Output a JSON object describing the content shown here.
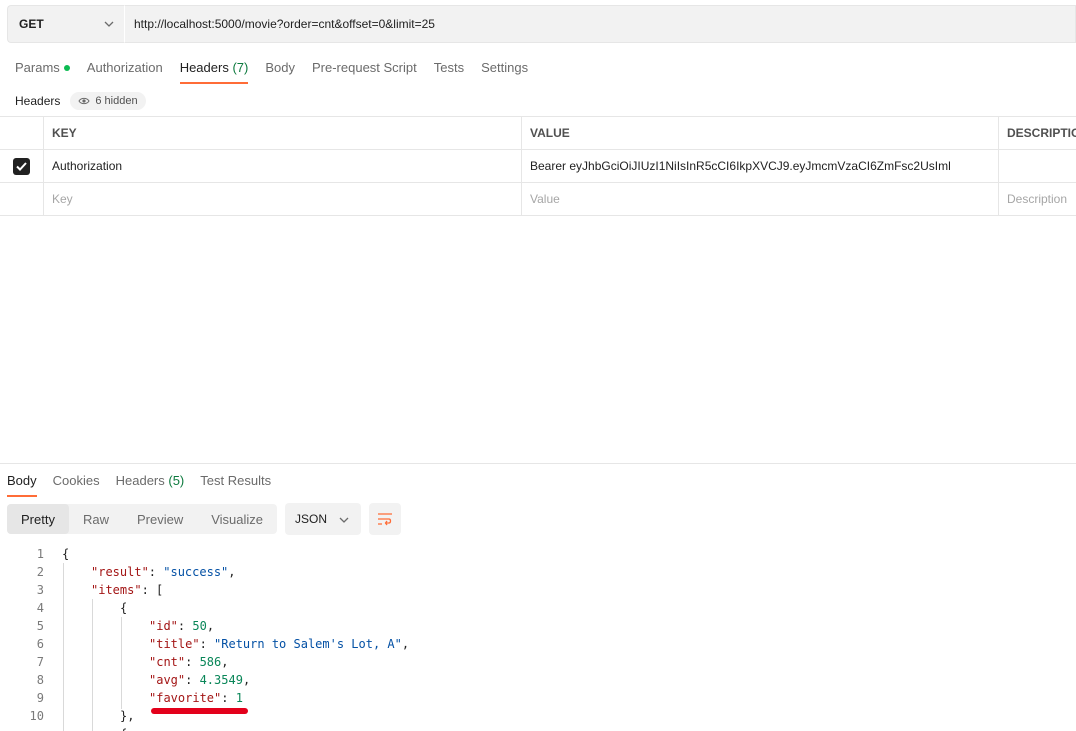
{
  "request": {
    "method": "GET",
    "url": "http://localhost:5000/movie?order=cnt&offset=0&limit=25"
  },
  "request_tabs": [
    {
      "label": "Params",
      "count": "",
      "active": false,
      "dot": true
    },
    {
      "label": "Authorization",
      "count": "",
      "active": false,
      "dot": false
    },
    {
      "label": "Headers",
      "count": "(7)",
      "active": true,
      "dot": false
    },
    {
      "label": "Body",
      "count": "",
      "active": false,
      "dot": false
    },
    {
      "label": "Pre-request Script",
      "count": "",
      "active": false,
      "dot": false
    },
    {
      "label": "Tests",
      "count": "",
      "active": false,
      "dot": false
    },
    {
      "label": "Settings",
      "count": "",
      "active": false,
      "dot": false
    }
  ],
  "headers_section": {
    "label": "Headers",
    "hidden_label": "6 hidden"
  },
  "headers_table": {
    "columns": [
      "KEY",
      "VALUE",
      "DESCRIPTIO"
    ],
    "rows": [
      {
        "checked": true,
        "key": "Authorization",
        "value": "Bearer eyJhbGciOiJIUzI1NiIsInR5cCI6IkpXVCJ9.eyJmcmVzaCI6ZmFsc2UsIml",
        "description": ""
      }
    ],
    "placeholder": {
      "key": "Key",
      "value": "Value",
      "description": "Description"
    }
  },
  "response_tabs": [
    {
      "label": "Body",
      "count": "",
      "active": true
    },
    {
      "label": "Cookies",
      "count": "",
      "active": false
    },
    {
      "label": "Headers",
      "count": "(5)",
      "active": false
    },
    {
      "label": "Test Results",
      "count": "",
      "active": false
    }
  ],
  "view_modes": [
    {
      "label": "Pretty",
      "active": true
    },
    {
      "label": "Raw",
      "active": false
    },
    {
      "label": "Preview",
      "active": false
    },
    {
      "label": "Visualize",
      "active": false
    }
  ],
  "format_select": "JSON",
  "code_lines": [
    {
      "n": "1",
      "indent": 0,
      "parts": [
        [
          "p",
          "{"
        ]
      ]
    },
    {
      "n": "2",
      "indent": 1,
      "parts": [
        [
          "k",
          "\"result\""
        ],
        [
          "p",
          ": "
        ],
        [
          "s",
          "\"success\""
        ],
        [
          "p",
          ","
        ]
      ]
    },
    {
      "n": "3",
      "indent": 1,
      "parts": [
        [
          "k",
          "\"items\""
        ],
        [
          "p",
          ": ["
        ]
      ]
    },
    {
      "n": "4",
      "indent": 2,
      "parts": [
        [
          "p",
          "{"
        ]
      ]
    },
    {
      "n": "5",
      "indent": 3,
      "parts": [
        [
          "k",
          "\"id\""
        ],
        [
          "p",
          ": "
        ],
        [
          "n",
          "50"
        ],
        [
          "p",
          ","
        ]
      ]
    },
    {
      "n": "6",
      "indent": 3,
      "parts": [
        [
          "k",
          "\"title\""
        ],
        [
          "p",
          ": "
        ],
        [
          "s",
          "\"Return to Salem's Lot, A\""
        ],
        [
          "p",
          ","
        ]
      ]
    },
    {
      "n": "7",
      "indent": 3,
      "parts": [
        [
          "k",
          "\"cnt\""
        ],
        [
          "p",
          ": "
        ],
        [
          "n",
          "586"
        ],
        [
          "p",
          ","
        ]
      ]
    },
    {
      "n": "8",
      "indent": 3,
      "parts": [
        [
          "k",
          "\"avg\""
        ],
        [
          "p",
          ": "
        ],
        [
          "n",
          "4.3549"
        ],
        [
          "p",
          ","
        ]
      ]
    },
    {
      "n": "9",
      "indent": 3,
      "parts": [
        [
          "k",
          "\"favorite\""
        ],
        [
          "p",
          ": "
        ],
        [
          "n",
          "1"
        ]
      ]
    },
    {
      "n": "10",
      "indent": 2,
      "parts": [
        [
          "p",
          "},"
        ]
      ]
    },
    {
      "n": "",
      "indent": 2,
      "parts": [
        [
          "p",
          "{"
        ]
      ]
    }
  ],
  "colors": {
    "accent": "#ff6c37",
    "annotation": "#e3001b",
    "json_key": "#a31515",
    "json_string": "#0451a5",
    "json_number": "#098658"
  }
}
